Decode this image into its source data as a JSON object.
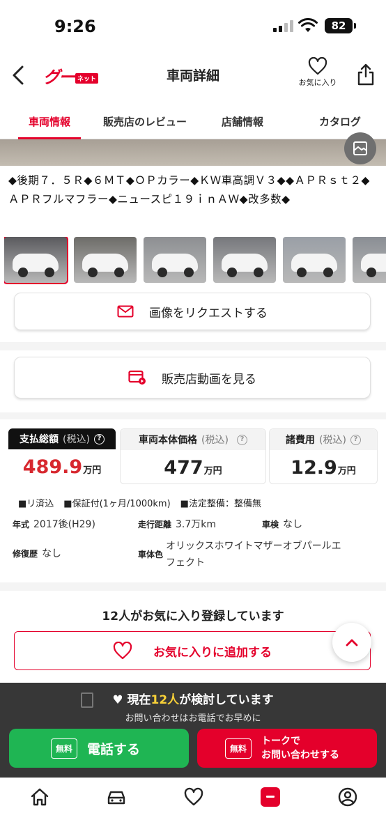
{
  "status_bar": {
    "time": "9:26",
    "battery": "82"
  },
  "header": {
    "logo_main": "グー",
    "logo_sub": "ネット",
    "title": "車両詳細",
    "favorite_label": "お気に入り"
  },
  "tabs": [
    {
      "label": "車両情報",
      "active": true
    },
    {
      "label": "販売店のレビュー",
      "active": false
    },
    {
      "label": "店舗情報",
      "active": false
    },
    {
      "label": "カタログ",
      "active": false
    }
  ],
  "listing": {
    "headline": "◆後期７．５Ｒ◆６ＭＴ◆ＯＰカラー◆ＫＷ車高調Ｖ３◆◆ＡＰＲｓｔ２◆ＡＰＲフルマフラー◆ニュースピ１９ｉｎＡＷ◆改多数◆"
  },
  "thumbnails": [
    {
      "bg": "#5a5a5e",
      "selected": true
    },
    {
      "bg": "#6d6c68",
      "selected": false
    },
    {
      "bg": "#8d8f92",
      "selected": false
    },
    {
      "bg": "#76787c",
      "selected": false
    },
    {
      "bg": "#9a9fa6",
      "selected": false
    },
    {
      "bg": "#8a8e94",
      "selected": false
    }
  ],
  "actions": {
    "request_images": "画像をリクエストする",
    "watch_video": "販売店動画を見る"
  },
  "prices": {
    "total": {
      "label": "支払総額",
      "tax": "(税込)",
      "value": "489.9",
      "unit": "万円"
    },
    "body": {
      "label": "車両本体価格",
      "tax": "(税込)",
      "value": "477",
      "unit": "万円"
    },
    "fees": {
      "label": "諸費用",
      "tax": "(税込)",
      "value": "12.9",
      "unit": "万円"
    }
  },
  "tags": [
    "■リ済込",
    "■保証付(1ヶ月/1000km)",
    "■法定整備：整備無"
  ],
  "specs": {
    "year_label": "年式",
    "year": "2017後(H29)",
    "mileage_label": "走行距離",
    "mileage": "3.7万km",
    "inspection_label": "車検",
    "inspection": "なし",
    "repair_label": "修復歴",
    "repair": "なし",
    "color_label": "車体色",
    "color_line1": "オリックスホワイトマザーオブパールエ",
    "color_line2": "フェクト"
  },
  "favorites": {
    "count_text": "12人がお気に入り登録しています",
    "add_label": "お気に入りに追加する"
  },
  "overlay": {
    "prefix": "現在",
    "count": "12人",
    "suffix": "が検討しています",
    "sub": "お問い合わせはお電話でお早めに"
  },
  "cta": {
    "free": "無料",
    "call": "電話する",
    "talk_line1": "トークで",
    "talk_line2": "お問い合わせする"
  },
  "colors": {
    "brand_red": "#e4002b",
    "green": "#1fb553",
    "highlight": "#f7d038"
  }
}
